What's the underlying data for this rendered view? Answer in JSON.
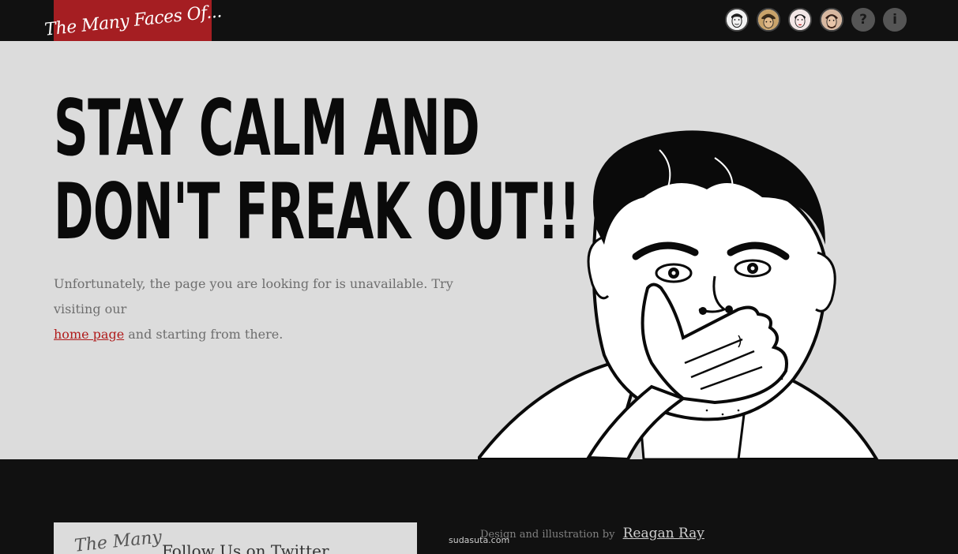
{
  "header": {
    "logo_text": "The Many Faces Of...",
    "nav": [
      {
        "name": "face-1",
        "icon": "portrait-avatar"
      },
      {
        "name": "face-2",
        "icon": "portrait-avatar"
      },
      {
        "name": "face-3",
        "icon": "portrait-avatar"
      },
      {
        "name": "face-4",
        "icon": "portrait-avatar"
      }
    ],
    "help_glyph": "?",
    "info_glyph": "i"
  },
  "main": {
    "headline_line1": "STAY CALM AND",
    "headline_line2": "DON'T FREAK OUT!!",
    "message_before": "Unfortunately, the page you are looking for is unavailable. Try visiting our",
    "message_link": "home page",
    "message_after": "and starting from there."
  },
  "footer": {
    "twitter_logo_text": "The Many",
    "twitter_label": "Follow Us on Twitter",
    "credit_text": "Design and illustration by",
    "credit_link": "Reagan Ray",
    "watermark": "sudasuta.com"
  },
  "colors": {
    "background": "#dcdcdc",
    "topbar": "#111111",
    "logo_bg": "#a51e22",
    "link": "#b01c1c"
  }
}
